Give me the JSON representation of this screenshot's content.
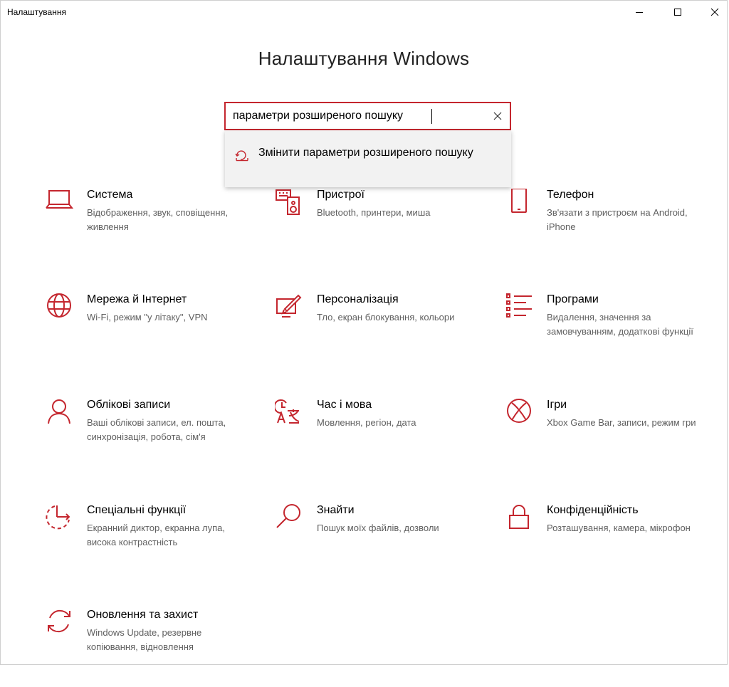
{
  "window": {
    "title": "Налаштування",
    "controls": {
      "minimize": "minimize-icon",
      "maximize": "maximize-icon",
      "close": "close-icon"
    }
  },
  "heading": "Налаштування Windows",
  "search": {
    "value": "параметри розширеного пошуку",
    "clear_icon": "clear-icon"
  },
  "suggestion": {
    "icon": "search-index-icon",
    "label": "Змінити параметри розширеного пошуку"
  },
  "accent_color": "#c4262e",
  "tiles": [
    {
      "title": "Система",
      "desc": "Відображення, звук, сповіщення, живлення",
      "icon": "laptop-icon"
    },
    {
      "title": "Пристрої",
      "desc": "Bluetooth, принтери, миша",
      "icon": "devices-icon"
    },
    {
      "title": "Телефон",
      "desc": "Зв'язати з пристроєм на Android, iPhone",
      "icon": "phone-icon"
    },
    {
      "title": "Мережа й Інтернет",
      "desc": "Wi-Fi, режим \"у літаку\", VPN",
      "icon": "globe-icon"
    },
    {
      "title": "Персоналізація",
      "desc": "Тло, екран блокування, кольори",
      "icon": "personalization-icon"
    },
    {
      "title": "Програми",
      "desc": "Видалення, значення за замовчуванням, додаткові функції",
      "icon": "apps-list-icon"
    },
    {
      "title": "Облікові записи",
      "desc": "Ваші облікові записи, ел. пошта, синхронізація, робота, сім'я",
      "icon": "person-icon"
    },
    {
      "title": "Час і мова",
      "desc": "Мовлення, регіон, дата",
      "icon": "time-language-icon"
    },
    {
      "title": "Ігри",
      "desc": "Xbox Game Bar, записи, режим гри",
      "icon": "xbox-icon"
    },
    {
      "title": "Спеціальні функції",
      "desc": "Екранний диктор, екранна лупа, висока контрастність",
      "icon": "accessibility-icon"
    },
    {
      "title": "Знайти",
      "desc": "Пошук моїх файлів, дозволи",
      "icon": "magnifier-icon"
    },
    {
      "title": "Конфіденційність",
      "desc": "Розташування, камера, мікрофон",
      "icon": "lock-icon"
    },
    {
      "title": "Оновлення та захист",
      "desc": "Windows Update, резервне копіювання, відновлення",
      "icon": "update-icon"
    }
  ]
}
